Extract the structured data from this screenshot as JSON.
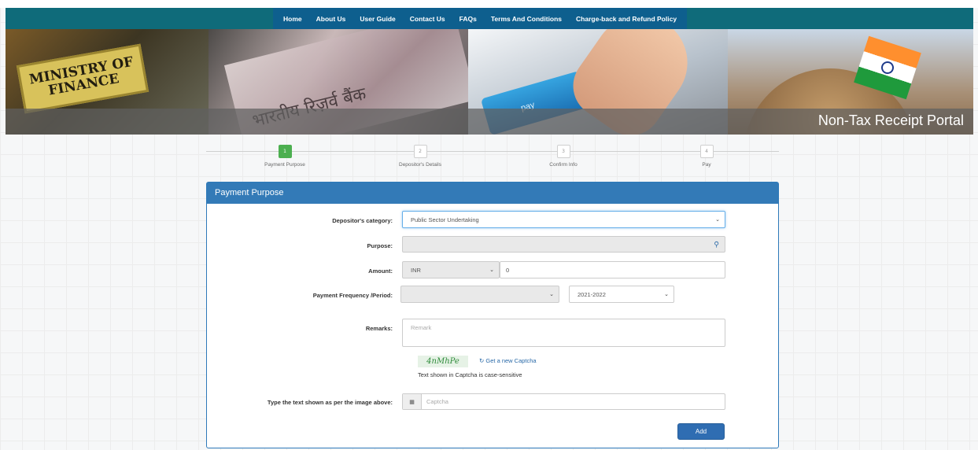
{
  "nav": {
    "items": [
      "Home",
      "About Us",
      "User Guide",
      "Contact Us",
      "FAQs",
      "Terms And Conditions",
      "Charge-back and Refund Policy"
    ]
  },
  "banner": {
    "ministry_text": "MINISTRY OF FINANCE",
    "note_text": "भारतीय रिज़र्व बैंक",
    "key_text": "pay",
    "portal_title": "Non-Tax Receipt Portal"
  },
  "steps": [
    {
      "number": "1",
      "label": "Payment Purpose",
      "active": true
    },
    {
      "number": "2",
      "label": "Depositor's Details",
      "active": false
    },
    {
      "number": "3",
      "label": "Confirm Info",
      "active": false
    },
    {
      "number": "4",
      "label": "Pay",
      "active": false
    }
  ],
  "form": {
    "title": "Payment Purpose",
    "depositor_category": {
      "label": "Depositor's category:",
      "value": "Public Sector Undertaking"
    },
    "purpose": {
      "label": "Purpose:",
      "value": ""
    },
    "amount": {
      "label": "Amount:",
      "currency": "INR",
      "value": "0"
    },
    "frequency": {
      "label": "Payment Frequency /Period:",
      "value": "",
      "period": "2021-2022"
    },
    "remarks": {
      "label": "Remarks:",
      "placeholder": "Remark"
    },
    "captcha": {
      "image_text": "4nMhPe",
      "refresh_label": "Get a new Captcha",
      "note": "Text shown in Captcha is case-sensitive",
      "input_label": "Type the text shown as per the image above:",
      "placeholder": "Captcha"
    },
    "add_label": "Add"
  },
  "colors": {
    "navbar": "#0f6b7a",
    "nav_group": "#0e5f8e",
    "card_header": "#337ab7",
    "step_active": "#4caf50",
    "button": "#2f6db2"
  }
}
